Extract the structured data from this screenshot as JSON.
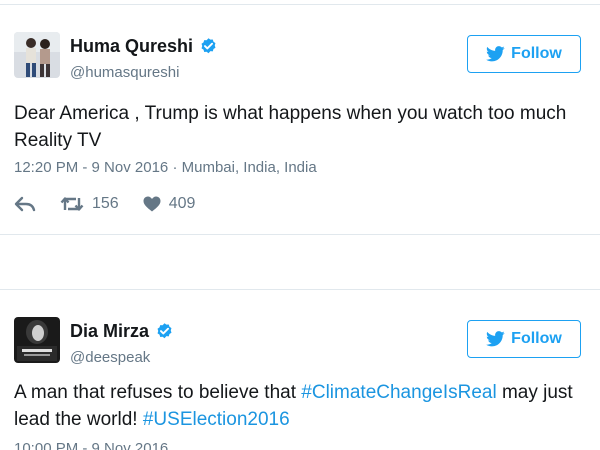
{
  "tweets": [
    {
      "display_name": "Huma Qureshi",
      "handle": "@humasqureshi",
      "follow_label": "Follow",
      "text": "Dear America , Trump is what happens when you watch too much Reality TV",
      "timestamp": "12:20 PM - 9 Nov 2016",
      "separator": "·",
      "location": "Mumbai, India, India",
      "retweets": "156",
      "likes": "409"
    },
    {
      "display_name": "Dia Mirza",
      "handle": "@deespeak",
      "follow_label": "Follow",
      "text_before": "A man that refuses to believe that ",
      "hashtag_1": "#ClimateChangeIsReal",
      "text_middle": " may just lead the world! ",
      "hashtag_2": "#USElection2016",
      "timestamp": "10:00 PM - 9 Nov 2016"
    }
  ],
  "colors": {
    "accent": "#1da1f2",
    "hashtag": "#1b95e0",
    "text": "#14171a",
    "muted": "#657786",
    "border": "#e1e8ed"
  },
  "icons": {
    "verified": "verified-badge-icon",
    "bird": "twitter-bird-icon",
    "reply": "reply-icon",
    "retweet": "retweet-icon",
    "like": "heart-icon"
  }
}
